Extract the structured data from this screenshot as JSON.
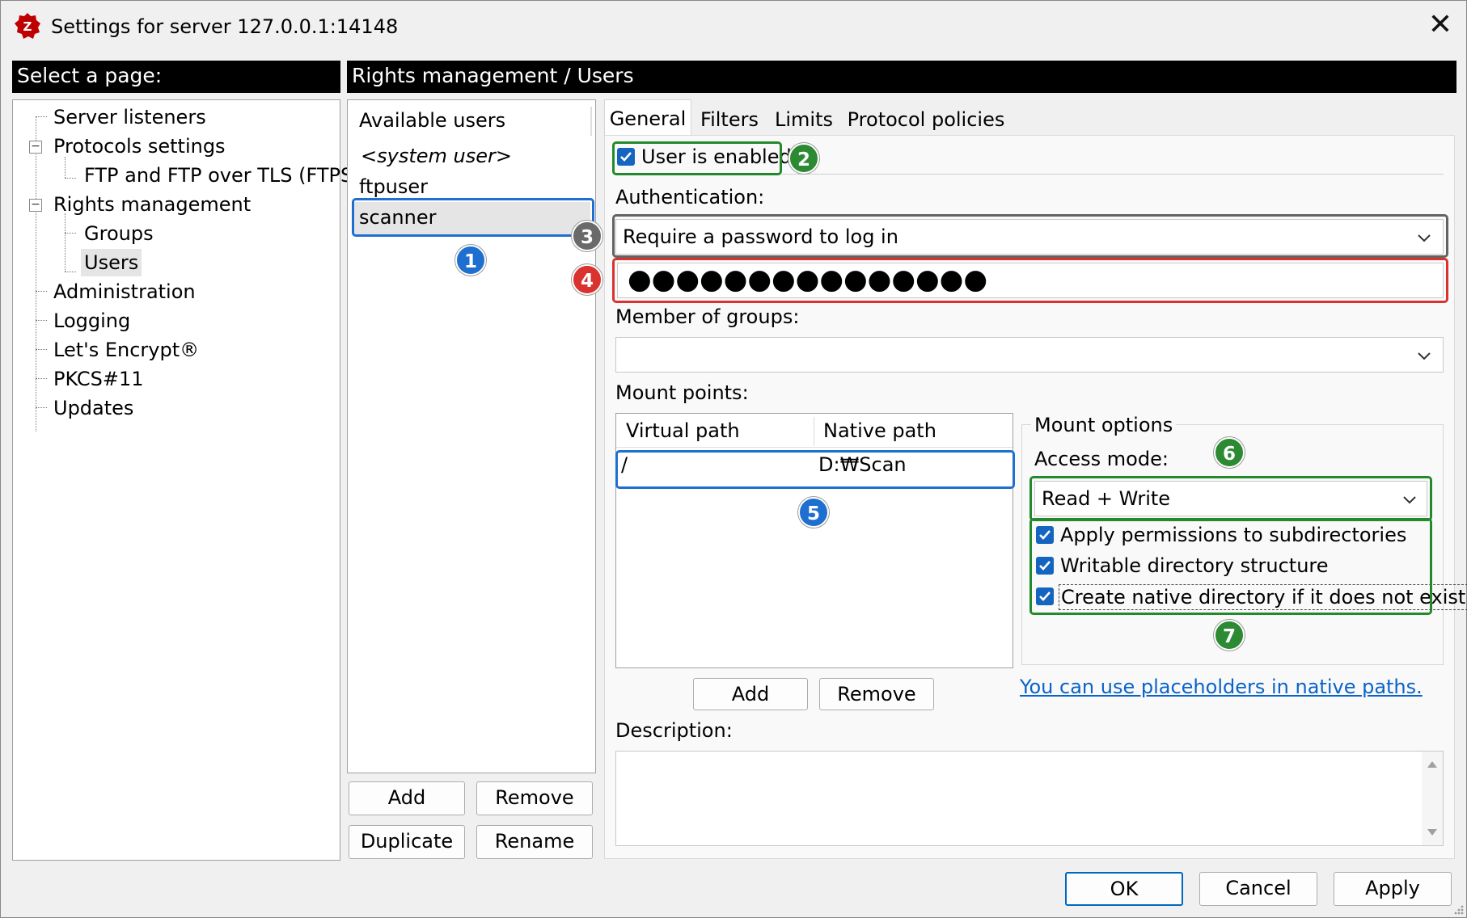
{
  "window": {
    "title": "Settings for server 127.0.0.1:14148",
    "close_glyph": "✕",
    "app_icon": "filezilla-server-icon"
  },
  "left": {
    "header": "Select a page:",
    "tree": [
      {
        "label": "Server listeners",
        "level": 0
      },
      {
        "label": "Protocols settings",
        "level": 0,
        "expander": "−"
      },
      {
        "label": "FTP and FTP over TLS (FTPS)",
        "level": 1
      },
      {
        "label": "Rights management",
        "level": 0,
        "expander": "−"
      },
      {
        "label": "Groups",
        "level": 1
      },
      {
        "label": "Users",
        "level": 1,
        "selected": true
      },
      {
        "label": "Administration",
        "level": 0
      },
      {
        "label": "Logging",
        "level": 0
      },
      {
        "label": "Let's Encrypt®",
        "level": 0
      },
      {
        "label": "PKCS#11",
        "level": 0
      },
      {
        "label": "Updates",
        "level": 0
      }
    ]
  },
  "right": {
    "header": "Rights management / Users"
  },
  "users": {
    "header": "Available users",
    "items": [
      "<system user>",
      "ftpuser",
      "scanner"
    ],
    "selected": "scanner",
    "buttons": {
      "add": "Add",
      "remove": "Remove",
      "duplicate": "Duplicate",
      "rename": "Rename"
    }
  },
  "tabs": [
    "General",
    "Filters",
    "Limits",
    "Protocol policies"
  ],
  "general": {
    "enabled_label": "User is enabled",
    "enabled": true,
    "auth_label": "Authentication:",
    "auth_value": "Require a password to log in",
    "password_mask": "●●●●●●●●●●●●●●●",
    "groups_label": "Member of groups:",
    "groups_value": "",
    "mount_label": "Mount points:",
    "mount_columns": [
      "Virtual path",
      "Native path"
    ],
    "mount_rows": [
      {
        "virtual": "/",
        "native": "D:₩Scan"
      }
    ],
    "mount_add": "Add",
    "mount_remove": "Remove",
    "mount_options": {
      "title": "Mount options",
      "access_label": "Access mode:",
      "access_value": "Read + Write",
      "checks": [
        {
          "label": "Apply permissions to subdirectories",
          "checked": true
        },
        {
          "label": "Writable directory structure",
          "checked": true
        },
        {
          "label": "Create native directory if it does not exist",
          "checked": true
        }
      ]
    },
    "placeholder_link": "You can use placeholders in native paths.",
    "description_label": "Description:",
    "description_value": ""
  },
  "footer": {
    "ok": "OK",
    "cancel": "Cancel",
    "apply": "Apply"
  },
  "badges": [
    "1",
    "2",
    "3",
    "4",
    "5",
    "6",
    "7"
  ],
  "colors": {
    "highlight_blue": "#1e6fd0",
    "highlight_green": "#238a2b",
    "highlight_gray": "#636363",
    "highlight_red": "#d9322f",
    "link": "#0a63c9",
    "checkbox": "#1565c0"
  }
}
